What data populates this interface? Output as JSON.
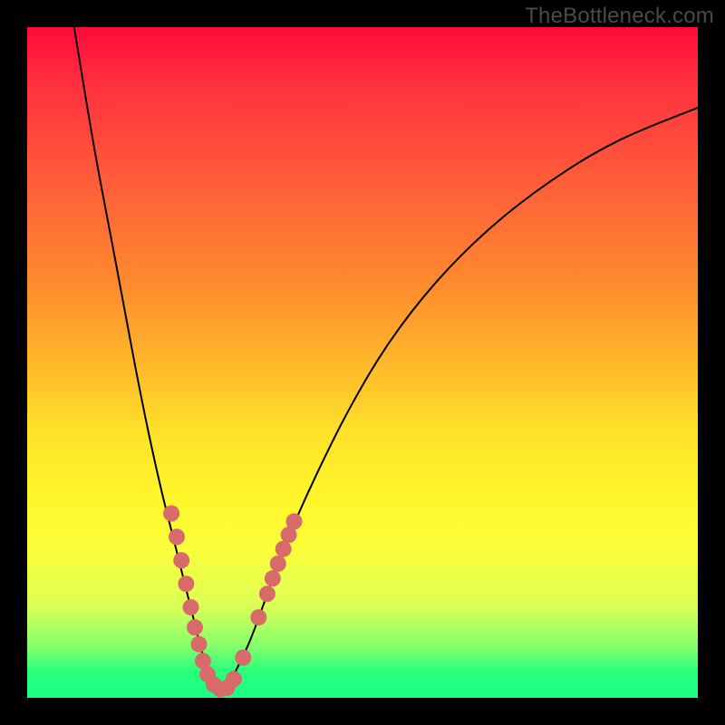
{
  "watermark": "TheBottleneck.com",
  "chart_data": {
    "type": "line",
    "title": "",
    "xlabel": "",
    "ylabel": "",
    "xlim": [
      0,
      100
    ],
    "ylim": [
      0,
      100
    ],
    "series": [
      {
        "name": "curve",
        "x": [
          7,
          10,
          13,
          16,
          18,
          20,
          22,
          24,
          25,
          26,
          27,
          28,
          29,
          30,
          33,
          36,
          39,
          43,
          48,
          54,
          61,
          69,
          78,
          88,
          100
        ],
        "y": [
          100,
          82,
          66,
          50,
          40,
          31,
          23,
          15,
          11,
          7,
          4,
          2,
          1,
          2,
          8,
          16,
          24,
          33,
          43,
          53,
          62,
          70,
          77,
          83,
          88
        ],
        "color": "#000000",
        "width": 2
      }
    ],
    "points": {
      "name": "markers",
      "color": "#d86a6a",
      "radius": 9,
      "coords": [
        [
          21.5,
          27.5
        ],
        [
          22.3,
          24.0
        ],
        [
          23.0,
          20.5
        ],
        [
          23.7,
          17.0
        ],
        [
          24.4,
          13.5
        ],
        [
          25.0,
          10.5
        ],
        [
          25.6,
          8.0
        ],
        [
          26.2,
          5.5
        ],
        [
          26.9,
          3.5
        ],
        [
          27.8,
          2.0
        ],
        [
          28.8,
          1.3
        ],
        [
          29.8,
          1.5
        ],
        [
          30.8,
          2.8
        ],
        [
          32.2,
          6.0
        ],
        [
          34.5,
          12.0
        ],
        [
          35.8,
          15.5
        ],
        [
          36.6,
          17.8
        ],
        [
          37.4,
          20.0
        ],
        [
          38.2,
          22.2
        ],
        [
          39.0,
          24.3
        ],
        [
          39.8,
          26.3
        ]
      ]
    },
    "notes": "Bottleneck-style V-curve; x and y are in percent of plot area (0–100). Values estimated from pixel positions; no axis labels or ticks are present in the source image."
  }
}
